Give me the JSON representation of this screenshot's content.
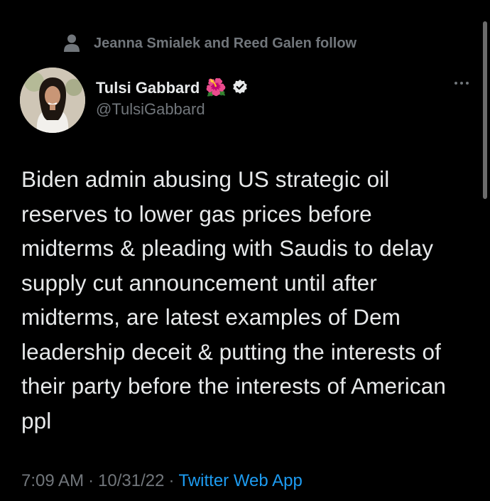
{
  "social_context": {
    "icon": "person-icon",
    "text": "Jeanna Smialek and Reed Galen follow"
  },
  "author": {
    "name": "Tulsi Gabbard",
    "emoji": "🌺",
    "handle": "@TulsiGabbard",
    "verified": true,
    "verified_color": "#e7e9ea"
  },
  "tweet": {
    "text": "Biden admin abusing US strategic oil reserves to lower gas prices before midterms & pleading with Saudis to delay supply cut announcement until after midterms, are latest examples of Dem leadership deceit & putting the interests of their party before the interests of American ppl"
  },
  "meta": {
    "time": "7:09 AM",
    "date": "10/31/22",
    "separator": "·",
    "source": "Twitter Web App"
  },
  "colors": {
    "background": "#000000",
    "primary_text": "#e7e9ea",
    "secondary_text": "#71767b",
    "link": "#1d9bf0"
  }
}
